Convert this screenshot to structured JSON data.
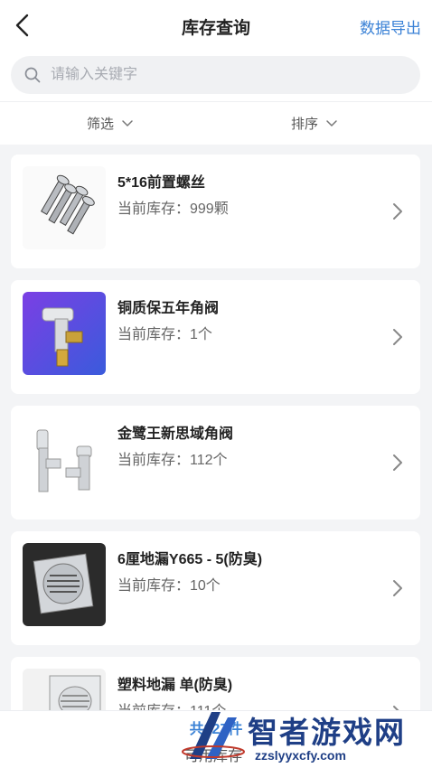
{
  "header": {
    "title": "库存查询",
    "export_label": "数据导出"
  },
  "search": {
    "placeholder": "请输入关键字"
  },
  "filters": {
    "filter_label": "筛选",
    "sort_label": "排序"
  },
  "items": [
    {
      "name": "5*16前置螺丝",
      "stock": "当前库存：999颗",
      "image": "screws-image"
    },
    {
      "name": "铜质保五年角阀",
      "stock": "当前库存：1个",
      "image": "angle-valve-image"
    },
    {
      "name": "金鹭王新思域角阀",
      "stock": "当前库存：112个",
      "image": "valves-image"
    },
    {
      "name": "6厘地漏Y665 - 5(防臭)",
      "stock": "当前库存：10个",
      "image": "floor-drain-image"
    },
    {
      "name": "塑料地漏 单(防臭)",
      "stock": "当前库存：111个",
      "image": "plastic-drain-image"
    }
  ],
  "footer": {
    "count": "共227件",
    "label": "可用库存"
  },
  "watermark": {
    "brand": "智者游戏网",
    "url": "zzslyyxcfy.com"
  },
  "colors": {
    "accent": "#3b82d6",
    "background": "#f3f4f6"
  }
}
